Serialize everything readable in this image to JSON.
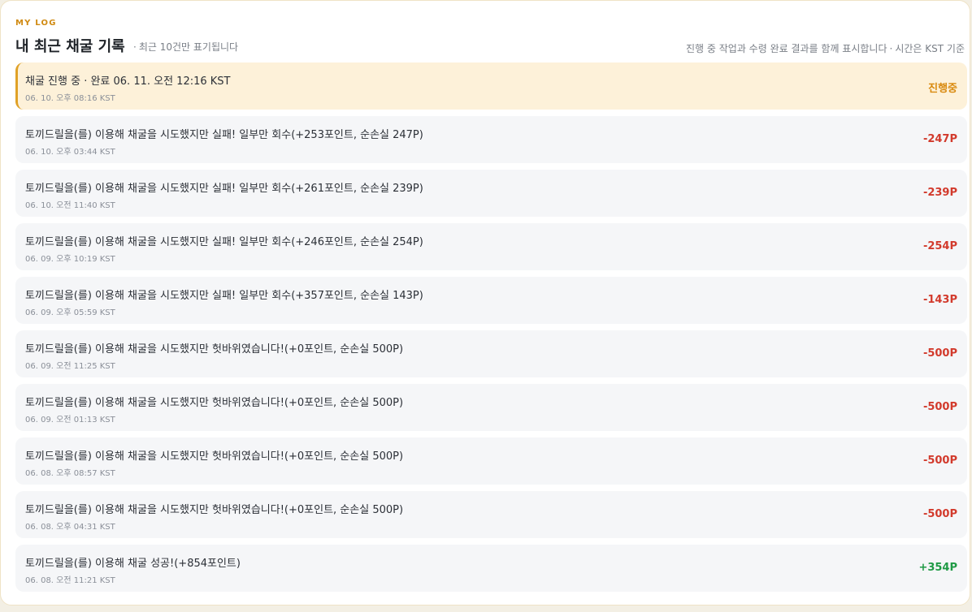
{
  "header": {
    "eyebrow": "MY LOG",
    "title": "내 최근 채굴 기록",
    "subtitle_dot": "·",
    "subtitle": "최근 10건만 표기됩니다",
    "note_main": "진행 중 작업과 수령 완료 결과를 함께 표시합니다",
    "note_dot": "·",
    "note_tz": "시간은 KST 기준"
  },
  "colors": {
    "accent": "#d08a12",
    "active_bg": "#fdf1d9",
    "active_border": "#e0a126",
    "loss": "#d23a2c",
    "gain": "#1f9a45"
  },
  "entries": [
    {
      "message": "채굴 진행 중 · 완료 06. 11. 오전 12:16 KST",
      "time": "06. 10. 오후 08:16 KST",
      "value": "진행중",
      "status": "pending"
    },
    {
      "message": "토끼드릴을(를) 이용해 채굴을 시도했지만 실패! 일부만 회수(+253포인트, 순손실 247P)",
      "time": "06. 10. 오후 03:44 KST",
      "value": "-247P",
      "status": "loss"
    },
    {
      "message": "토끼드릴을(를) 이용해 채굴을 시도했지만 실패! 일부만 회수(+261포인트, 순손실 239P)",
      "time": "06. 10. 오전 11:40 KST",
      "value": "-239P",
      "status": "loss"
    },
    {
      "message": "토끼드릴을(를) 이용해 채굴을 시도했지만 실패! 일부만 회수(+246포인트, 순손실 254P)",
      "time": "06. 09. 오후 10:19 KST",
      "value": "-254P",
      "status": "loss"
    },
    {
      "message": "토끼드릴을(를) 이용해 채굴을 시도했지만 실패! 일부만 회수(+357포인트, 순손실 143P)",
      "time": "06. 09. 오후 05:59 KST",
      "value": "-143P",
      "status": "loss"
    },
    {
      "message": "토끼드릴을(를) 이용해 채굴을 시도했지만 헛바위였습니다!(+0포인트, 순손실 500P)",
      "time": "06. 09. 오전 11:25 KST",
      "value": "-500P",
      "status": "loss"
    },
    {
      "message": "토끼드릴을(를) 이용해 채굴을 시도했지만 헛바위였습니다!(+0포인트, 순손실 500P)",
      "time": "06. 09. 오전 01:13 KST",
      "value": "-500P",
      "status": "loss"
    },
    {
      "message": "토끼드릴을(를) 이용해 채굴을 시도했지만 헛바위였습니다!(+0포인트, 순손실 500P)",
      "time": "06. 08. 오후 08:57 KST",
      "value": "-500P",
      "status": "loss"
    },
    {
      "message": "토끼드릴을(를) 이용해 채굴을 시도했지만 헛바위였습니다!(+0포인트, 순손실 500P)",
      "time": "06. 08. 오후 04:31 KST",
      "value": "-500P",
      "status": "loss"
    },
    {
      "message": "토끼드릴을(를) 이용해 채굴 성공!(+854포인트)",
      "time": "06. 08. 오전 11:21 KST",
      "value": "+354P",
      "status": "gain"
    }
  ]
}
